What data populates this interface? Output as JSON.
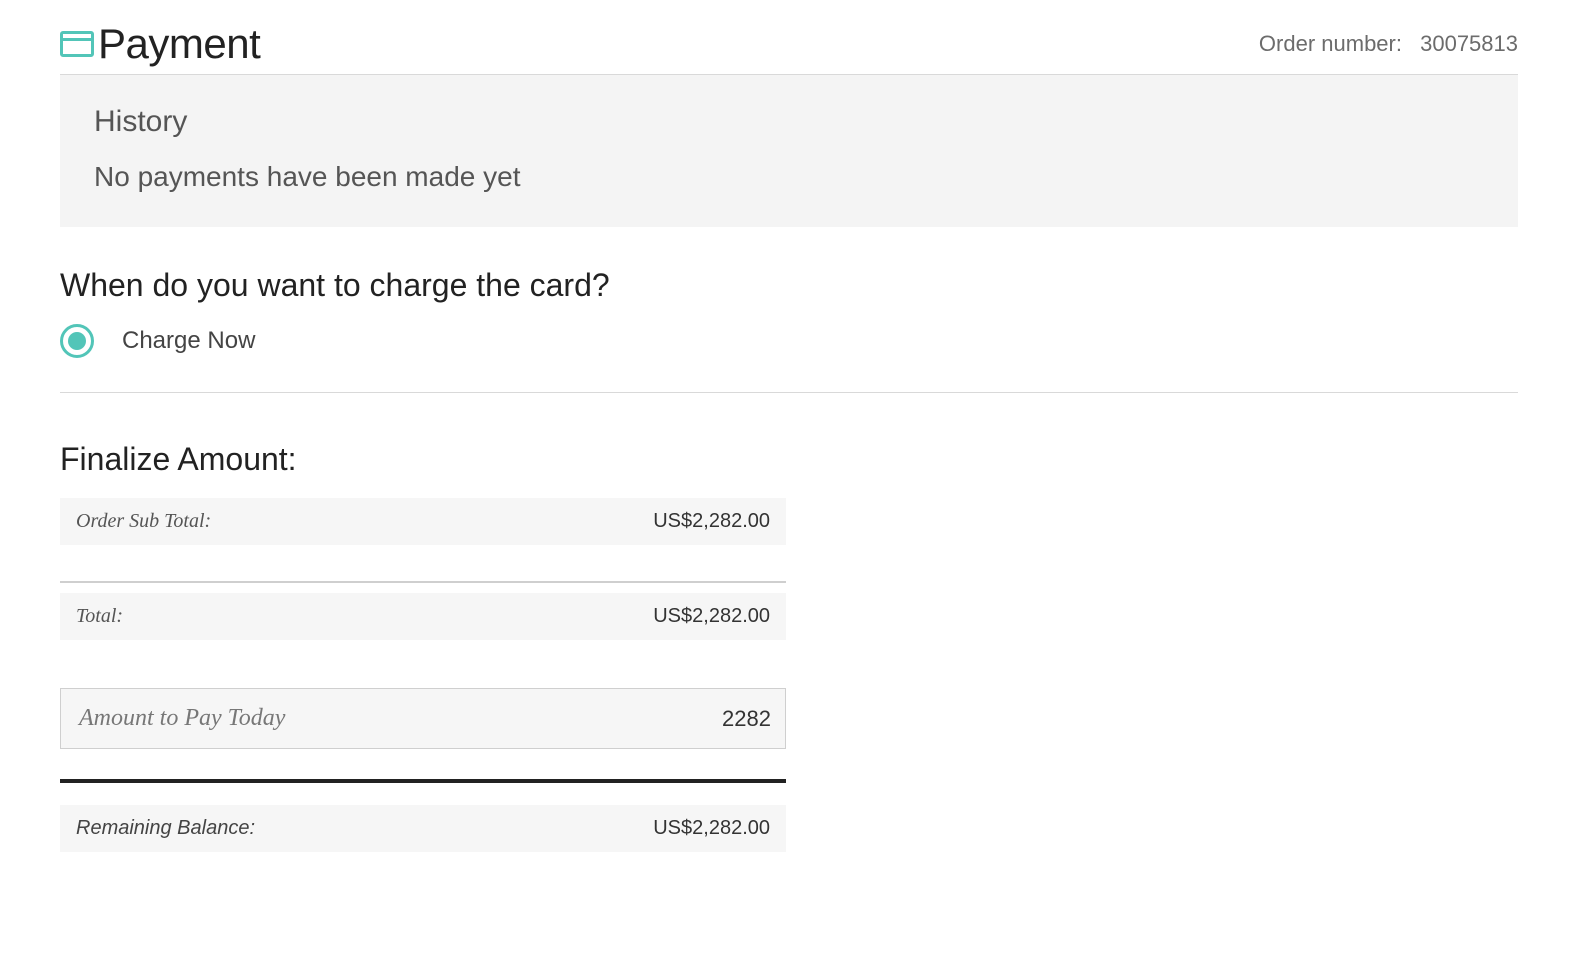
{
  "header": {
    "title": "Payment",
    "order_label": "Order number:",
    "order_value": "30075813"
  },
  "history": {
    "title": "History",
    "empty_text": "No payments have been made yet"
  },
  "charge": {
    "heading": "When do you want to charge the card?",
    "option_now": "Charge Now"
  },
  "finalize": {
    "heading": "Finalize Amount:",
    "subtotal_label": "Order Sub Total:",
    "subtotal_value": "US$2,282.00",
    "total_label": "Total:",
    "total_value": "US$2,282.00",
    "amount_to_pay_label": "Amount to Pay Today",
    "amount_to_pay_value": "2282",
    "remaining_label": "Remaining Balance:",
    "remaining_value": "US$2,282.00"
  }
}
